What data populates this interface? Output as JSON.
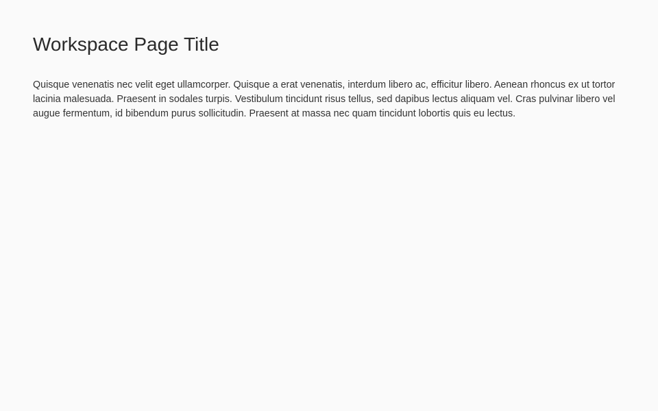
{
  "page": {
    "title": "Workspace Page Title",
    "paragraph": "Quisque venenatis nec velit eget ullamcorper. Quisque a erat venenatis, interdum libero ac, efficitur libero. Aenean rhoncus ex ut tortor lacinia malesuada. Praesent in sodales turpis. Vestibulum tincidunt risus tellus, sed dapibus lectus aliquam vel. Cras pulvinar libero vel augue fermentum, id bibendum purus sollicitudin. Praesent at massa nec quam tincidunt lobortis quis eu lectus."
  },
  "colors": {
    "background": "#fafafa",
    "title_text": "#2a2a2a",
    "body_text": "#333333"
  }
}
